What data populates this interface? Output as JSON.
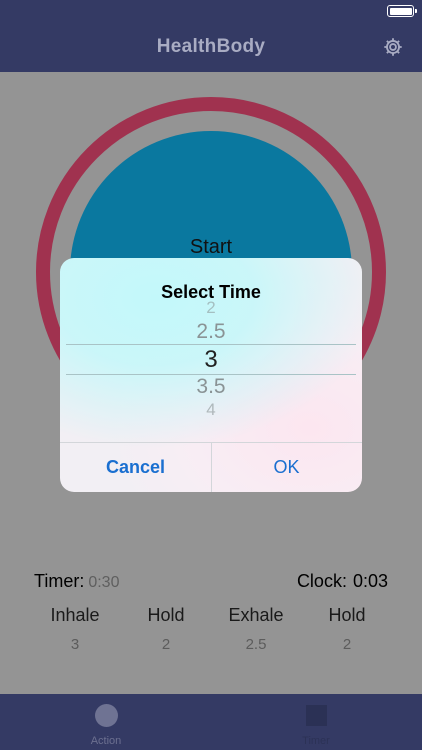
{
  "header": {
    "title": "HealthBody",
    "settings_icon": "gear-icon"
  },
  "colors": {
    "nav_bar": "#343a64",
    "ring": "#a0324f",
    "circle": "#0a789f",
    "accent_button": "#1a6fd0",
    "overlay_background": "#949494"
  },
  "breath_circle": {
    "label": "Start"
  },
  "dialog": {
    "title": "Select Time",
    "options": [
      "2",
      "2.5",
      "3",
      "3.5",
      "4"
    ],
    "selected": "3",
    "cancel_label": "Cancel",
    "ok_label": "OK"
  },
  "stats": {
    "timer_label": "Timer:",
    "timer_value": "0:30",
    "clock_label": "Clock:",
    "clock_value": "0:03",
    "phases": [
      {
        "label": "Inhale",
        "value": "3"
      },
      {
        "label": "Hold",
        "value": "2"
      },
      {
        "label": "Exhale",
        "value": "2.5"
      },
      {
        "label": "Hold",
        "value": "2"
      }
    ]
  },
  "tabbar": {
    "items": [
      {
        "label": "Action",
        "icon": "circle-icon"
      },
      {
        "label": "Timer",
        "icon": "square-icon"
      }
    ]
  }
}
